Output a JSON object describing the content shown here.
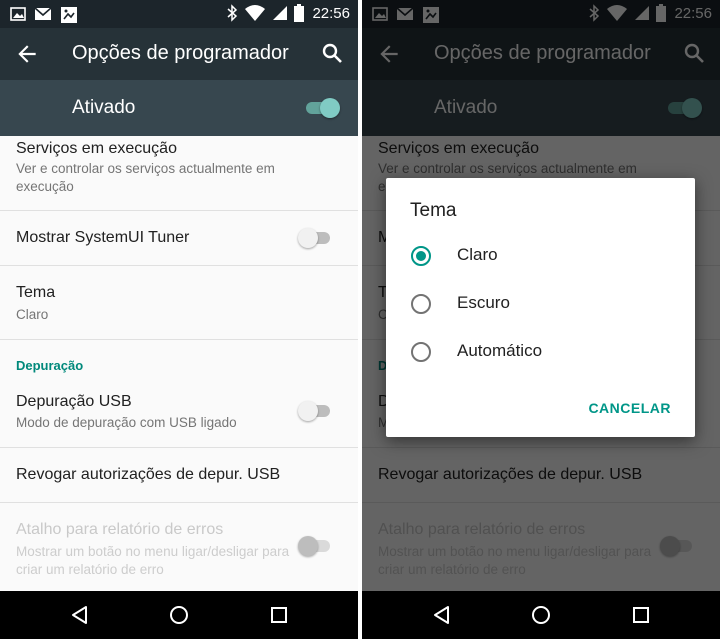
{
  "status_bar": {
    "time": "22:56",
    "icons": [
      "image-icon",
      "gmail-icon",
      "photo-sync-icon",
      "bluetooth-icon",
      "wifi-icon",
      "signal-icon",
      "battery-icon"
    ]
  },
  "toolbar": {
    "title": "Opções de programador",
    "icons": [
      "back-arrow-icon",
      "search-icon"
    ]
  },
  "master_switch": {
    "label": "Ativado",
    "checked": true
  },
  "settings": {
    "running_services": {
      "title": "Serviços em execução",
      "summary": "Ver e controlar os serviços actualmente em execução"
    },
    "systemui_tuner": {
      "title": "Mostrar SystemUI Tuner",
      "checked": false
    },
    "theme": {
      "title": "Tema",
      "summary": "Claro"
    },
    "debug_category": "Depuração",
    "usb_debugging": {
      "title": "Depuração USB",
      "summary": "Modo de depuração com USB ligado",
      "checked": false
    },
    "revoke_usb": {
      "title": "Revogar autorizações de depur. USB"
    },
    "bug_report_shortcut": {
      "title": "Atalho para relatório de erros",
      "summary": "Mostrar um botão no menu ligar/desligar para criar um relatório de erro",
      "enabled": false,
      "checked": false
    }
  },
  "dialog": {
    "title": "Tema",
    "options": [
      {
        "label": "Claro",
        "selected": true
      },
      {
        "label": "Escuro",
        "selected": false
      },
      {
        "label": "Automático",
        "selected": false
      }
    ],
    "cancel_label": "CANCELAR"
  },
  "nav_bar": {
    "icons": [
      "back-triangle-icon",
      "home-circle-icon",
      "recents-square-icon"
    ]
  },
  "colors": {
    "accent": "#009688",
    "toolbar": "#263238",
    "master_bar": "#37474f",
    "status_bar": "#1c252b"
  }
}
